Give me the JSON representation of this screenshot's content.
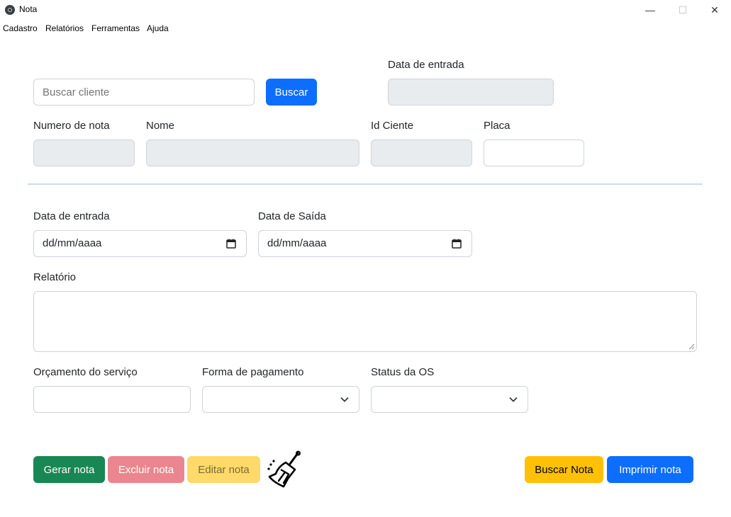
{
  "window": {
    "title": "Nota",
    "minimize": "—",
    "maximize": "☐",
    "close": "✕"
  },
  "menu": {
    "items": [
      "Cadastro",
      "Relatórios",
      "Ferramentas",
      "Ajuda"
    ]
  },
  "search": {
    "placeholder": "Buscar cliente",
    "button_label": "Buscar"
  },
  "entry_top": {
    "label": "Data de entrada",
    "value": ""
  },
  "fields": {
    "numero_label": "Numero de nota",
    "nome_label": "Nome",
    "id_cliente_label": "Id Ciente",
    "placa_label": "Placa"
  },
  "dates": {
    "entrada_label": "Data de entrada",
    "saida_label": "Data de Saída",
    "entrada_value": "dd/mm/aaaa",
    "saida_value": "dd/mm/aaaa"
  },
  "relatorio": {
    "label": "Relatório",
    "value": ""
  },
  "orcamento": {
    "label": "Orçamento do serviço",
    "value": ""
  },
  "pagamento": {
    "label": "Forma de pagamento",
    "selected": ""
  },
  "status": {
    "label": "Status da OS",
    "selected": ""
  },
  "actions": {
    "gerar": "Gerar nota",
    "excluir": "Excluir nota",
    "editar": "Editar nota",
    "clear_icon": "broom-icon",
    "buscar_nota": "Buscar Nota",
    "imprimir": "Imprimir nota"
  },
  "colors": {
    "primary": "#0d6efd",
    "success": "#198754",
    "danger_disabled": "#ea868f",
    "warning_disabled": "#ffda6a",
    "warning": "#ffc107",
    "disabled_bg": "#e9ecef",
    "divider": "#c8ddef"
  }
}
